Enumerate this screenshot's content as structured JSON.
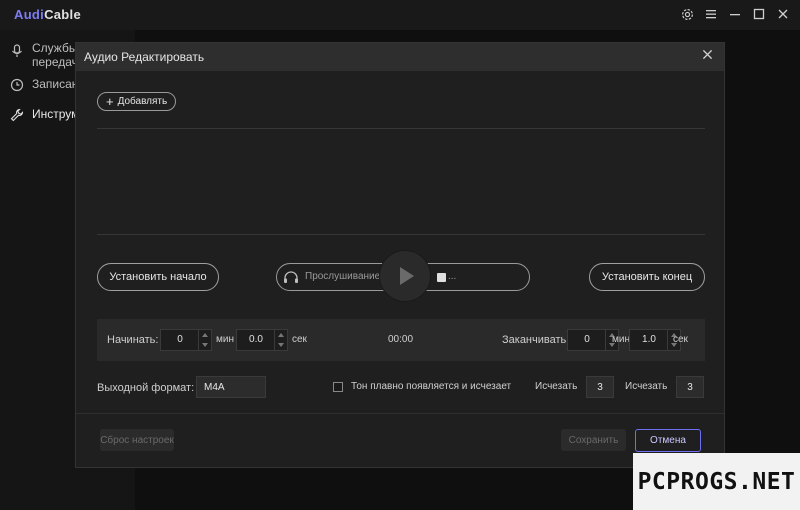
{
  "app": {
    "logo_part1": "Audi",
    "logo_part2": "Cable",
    "accent": "#6e6ef0"
  },
  "window_controls": [
    "gear-icon",
    "menu-icon",
    "minimize-icon",
    "maximize-icon",
    "close-icon"
  ],
  "sidebar": {
    "items": [
      {
        "label": "Службы",
        "label2": "передач",
        "icon": "microphone-icon"
      },
      {
        "label": "Записан",
        "icon": "clock-icon"
      },
      {
        "label": "Инструм",
        "icon": "wrench-icon",
        "active": true
      }
    ]
  },
  "dialog": {
    "title": "Аудио Редактировать",
    "add_label": "Добавлять",
    "set_start_label": "Установить начало",
    "set_end_label": "Установить конец",
    "player": {
      "listen_label": "Прослушивание",
      "trail": "..."
    },
    "time": {
      "start_label": "Начинать:",
      "start_min": "0",
      "start_sec": "0.0",
      "min_unit": "мин",
      "sec_unit": "сек",
      "current": "00:00",
      "end_label": "Заканчивать:",
      "end_min": "0",
      "end_sec": "1.0"
    },
    "output": {
      "format_label": "Выходной формат:",
      "format_value": "M4A",
      "fade_checkbox_label": "Тон плавно появляется и исчезает",
      "fade_in_label": "Исчезать",
      "fade_in_value": "3",
      "fade_out_label": "Исчезать",
      "fade_out_value": "3"
    },
    "reset_label": "Сброс настроек",
    "save_label": "Сохранить",
    "cancel_label": "Отмена"
  },
  "watermark": "PCPROGS.NET"
}
